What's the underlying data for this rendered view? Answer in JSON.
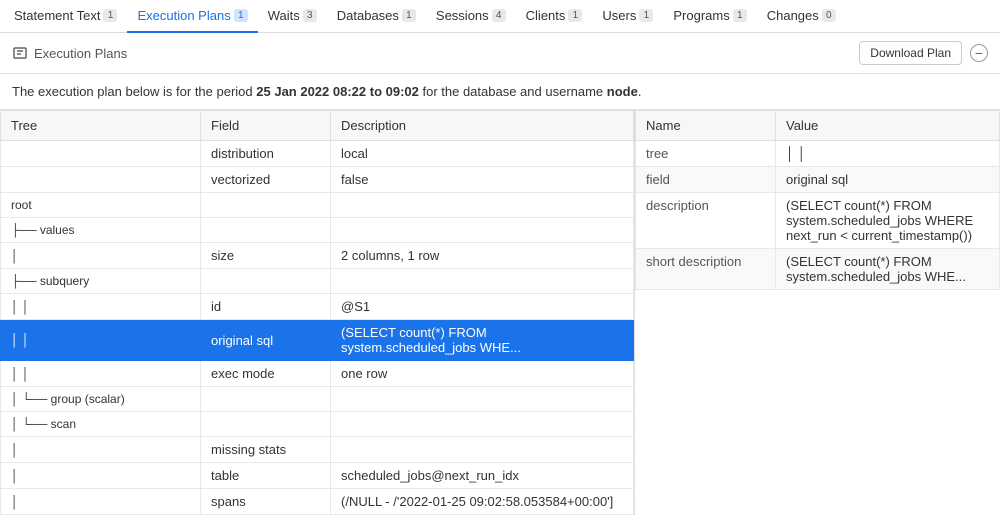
{
  "nav": {
    "tabs": [
      {
        "id": "statement-text",
        "label": "Statement Text",
        "badge": "1",
        "active": false
      },
      {
        "id": "execution-plans",
        "label": "Execution Plans",
        "badge": "1",
        "active": true
      },
      {
        "id": "waits",
        "label": "Waits",
        "badge": "3",
        "active": false
      },
      {
        "id": "databases",
        "label": "Databases",
        "badge": "1",
        "active": false
      },
      {
        "id": "sessions",
        "label": "Sessions",
        "badge": "4",
        "active": false
      },
      {
        "id": "clients",
        "label": "Clients",
        "badge": "1",
        "active": false
      },
      {
        "id": "users",
        "label": "Users",
        "badge": "1",
        "active": false
      },
      {
        "id": "programs",
        "label": "Programs",
        "badge": "1",
        "active": false
      },
      {
        "id": "changes",
        "label": "Changes",
        "badge": "0",
        "active": false
      }
    ]
  },
  "subheader": {
    "title": "Execution Plans",
    "download_label": "Download Plan",
    "collapse_label": "−"
  },
  "info": {
    "prefix": "The execution plan below is for the period ",
    "period": "25 Jan 2022 08:22 to 09:02",
    "middle": " for the database and username ",
    "username": "node",
    "suffix": "."
  },
  "table": {
    "headers": [
      "Tree",
      "Field",
      "Description"
    ],
    "rows": [
      {
        "tree": "",
        "field": "distribution",
        "description": "local",
        "selected": false
      },
      {
        "tree": "",
        "field": "vectorized",
        "description": "false",
        "selected": false
      },
      {
        "tree": "root",
        "field": "",
        "description": "",
        "selected": false
      },
      {
        "tree": "├── values",
        "field": "",
        "description": "",
        "selected": false
      },
      {
        "tree": "│",
        "field": "size",
        "description": "2 columns, 1 row",
        "selected": false
      },
      {
        "tree": "├── subquery",
        "field": "",
        "description": "",
        "selected": false
      },
      {
        "tree": "│ │",
        "field": "id",
        "description": "@S1",
        "selected": false
      },
      {
        "tree": "│ │",
        "field": "original sql",
        "description": "(SELECT count(*) FROM system.scheduled_jobs WHE...",
        "selected": true
      },
      {
        "tree": "│ │",
        "field": "exec mode",
        "description": "one row",
        "selected": false
      },
      {
        "tree": "│  └── group (scalar)",
        "field": "",
        "description": "",
        "selected": false
      },
      {
        "tree": "│  └── scan",
        "field": "",
        "description": "",
        "selected": false
      },
      {
        "tree": "│",
        "field": "missing stats",
        "description": "",
        "selected": false
      },
      {
        "tree": "│",
        "field": "table",
        "description": "scheduled_jobs@next_run_idx",
        "selected": false
      },
      {
        "tree": "│",
        "field": "spans",
        "description": "(/NULL - /'2022-01-25 09:02:58.053584+00:00']",
        "selected": false
      }
    ]
  },
  "detail_panel": {
    "headers": [
      "Name",
      "Value"
    ],
    "rows": [
      {
        "name": "tree",
        "value": "│ │"
      },
      {
        "name": "field",
        "value": "original sql"
      },
      {
        "name": "description",
        "value": "(SELECT count(*) FROM system.scheduled_jobs WHERE next_run < current_timestamp())"
      },
      {
        "name": "short description",
        "value": "(SELECT count(*) FROM system.scheduled_jobs WHE..."
      }
    ]
  }
}
